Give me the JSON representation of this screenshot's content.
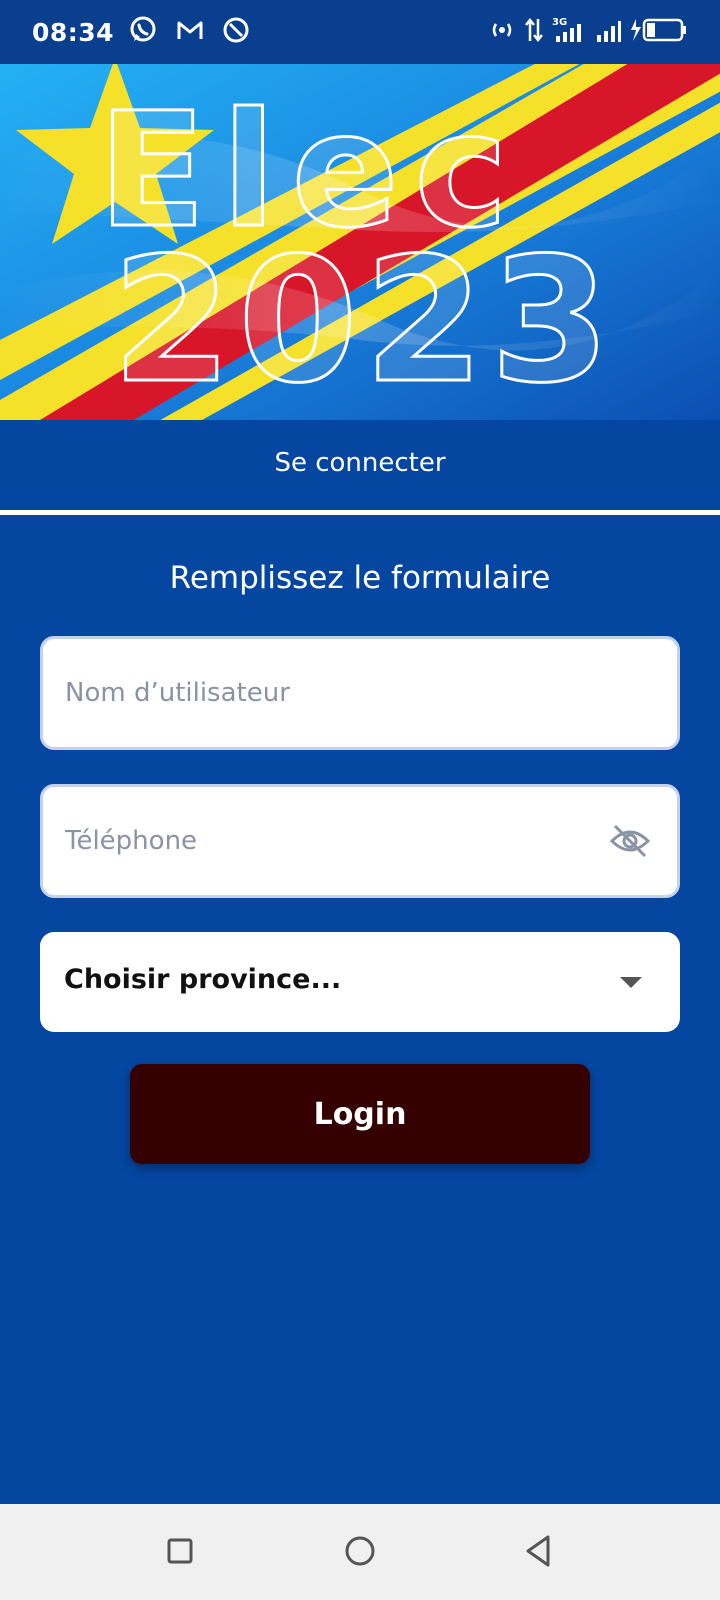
{
  "status_bar": {
    "time": "08:34",
    "left_icons": [
      "whatsapp-icon",
      "gmail-icon",
      "vpn-icon"
    ],
    "right_icons": [
      "hotspot-icon",
      "data-transfer-icon",
      "network-3g-signal-icon",
      "signal-icon",
      "battery-charging-icon"
    ]
  },
  "banner": {
    "line1": "Elec",
    "line2": "2023"
  },
  "tab": {
    "label": "Se connecter"
  },
  "form": {
    "title": "Remplissez le formulaire",
    "username_placeholder": "Nom d’utilisateur",
    "phone_placeholder": "Téléphone",
    "province_select": "Choisir province...",
    "login_label": "Login"
  },
  "nav": {
    "icons": [
      "recents-icon",
      "home-icon",
      "back-icon"
    ]
  },
  "colors": {
    "background": "#0446a0",
    "login_button": "#340000",
    "flag_blue": "#1e8fe6",
    "flag_yellow": "#f5e12a",
    "flag_red": "#d8162a"
  }
}
